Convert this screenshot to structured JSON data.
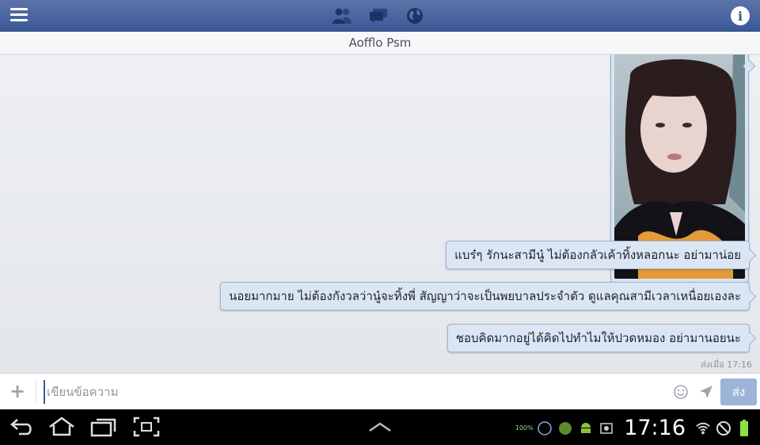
{
  "header": {
    "menu_icon": "hamburger-menu-icon",
    "jewels": [
      "friends-icon",
      "messages-icon",
      "globe-icon"
    ],
    "info_label": "i",
    "accent": "#3b5998"
  },
  "conversation": {
    "title": "Aofflo Psm",
    "messages": [
      "แบร๋ๆ รักนะสามีนู๋ ไม่ต้องกลัวเค้าทิ้งหลอกนะ อย่ามาน่อย",
      "นอยมากมาย ไม่ต้องกังวลว่านู๋จะทิ้งพี่ สัญญาว่าจะเป็นพยบาลประจำตัว ดูแลคุณสามีเวลาเหนื่อยเองละ",
      "ชอบคิดมากอยู่ได้คิดไปทำไมให้ปวดหมอง อย่ามานอยนะ"
    ],
    "timestamp": "ส่งเมื่อ 17:16"
  },
  "composer": {
    "placeholder": "เขียนข้อความ",
    "value": "",
    "send_label": "ส่ง",
    "plus_label": "+"
  },
  "system_bar": {
    "time": "17:16",
    "battery_text": "100%",
    "badge_text": "100"
  }
}
